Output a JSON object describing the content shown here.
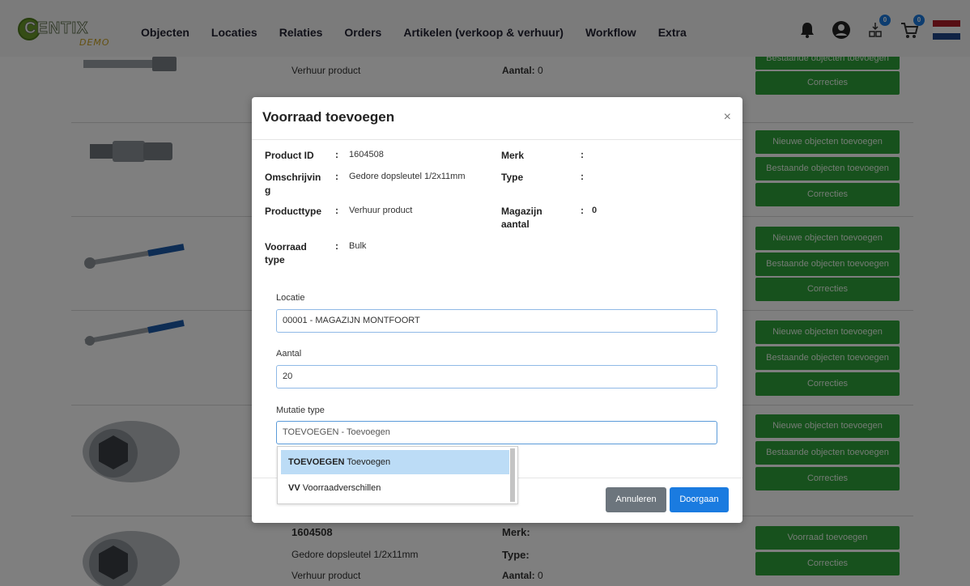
{
  "app": {
    "brand": "CENTIX",
    "brand_sub": "DEMO"
  },
  "nav": {
    "items": [
      "Objecten",
      "Locaties",
      "Relaties",
      "Orders",
      "Artikelen (verkoop & verhuur)",
      "Workflow",
      "Extra"
    ],
    "badges": {
      "objects": "0",
      "cart": "0"
    }
  },
  "background": {
    "rows": [
      {
        "type_text": "Verhuur product",
        "count_label": "Aantal:",
        "count_value": "0",
        "buttons": [
          "Bestaande objecten toevoegen",
          "Correcties"
        ]
      },
      {
        "buttons": [
          "Nieuwe objecten toevoegen",
          "Bestaande objecten toevoegen",
          "Correcties"
        ]
      },
      {
        "buttons": [
          "Nieuwe objecten toevoegen",
          "Bestaande objecten toevoegen",
          "Correcties"
        ]
      },
      {
        "buttons": [
          "Nieuwe objecten toevoegen",
          "Bestaande objecten toevoegen",
          "Correcties"
        ]
      },
      {
        "buttons": [
          "Nieuwe objecten toevoegen",
          "Bestaande objecten toevoegen",
          "Correcties"
        ]
      },
      {
        "product_id": "1604508",
        "description": "Gedore dopsleutel 1/2x11mm",
        "type_text": "Verhuur product",
        "brand_label": "Merk:",
        "type_label": "Type:",
        "count_label": "Aantal:",
        "count_value": "0",
        "buttons": [
          "Voorraad toevoegen",
          "Correcties"
        ]
      }
    ]
  },
  "modal": {
    "title": "Voorraad toevoegen",
    "close": "×",
    "info": {
      "product_id_label": "Product ID",
      "product_id": "1604508",
      "description_label_1": "Omschrijvin",
      "description_label_2": "g",
      "description": "Gedore dopsleutel 1/2x11mm",
      "producttype_label": "Producttype",
      "producttype": "Verhuur product",
      "stock_type_label_1": "Voorraad",
      "stock_type_label_2": "type",
      "stock_type": "Bulk",
      "brand_label": "Merk",
      "brand": "",
      "type_label": "Type",
      "type": "",
      "warehouse_label_1": "Magazijn",
      "warehouse_label_2": "aantal",
      "warehouse_count": "0",
      "colon": ":"
    },
    "form": {
      "location_label": "Locatie",
      "location_value": "00001 - MAGAZIJN MONTFOORT",
      "amount_label": "Aantal",
      "amount_value": "20",
      "mutation_label": "Mutatie type",
      "mutation_value": "TOEVOEGEN - Toevoegen",
      "mutation_options": [
        {
          "code": "TOEVOEGEN",
          "text": "Toevoegen",
          "selected": true
        },
        {
          "code": "VV",
          "text": "Voorraadverschillen",
          "selected": false
        }
      ]
    },
    "buttons": {
      "cancel": "Annuleren",
      "continue": "Doorgaan"
    }
  },
  "colors": {
    "green_button": "#2ea33a",
    "primary_blue": "#1a7be0",
    "cancel_gray": "#6c757d",
    "dropdown_highlight": "#bcdcf6"
  }
}
